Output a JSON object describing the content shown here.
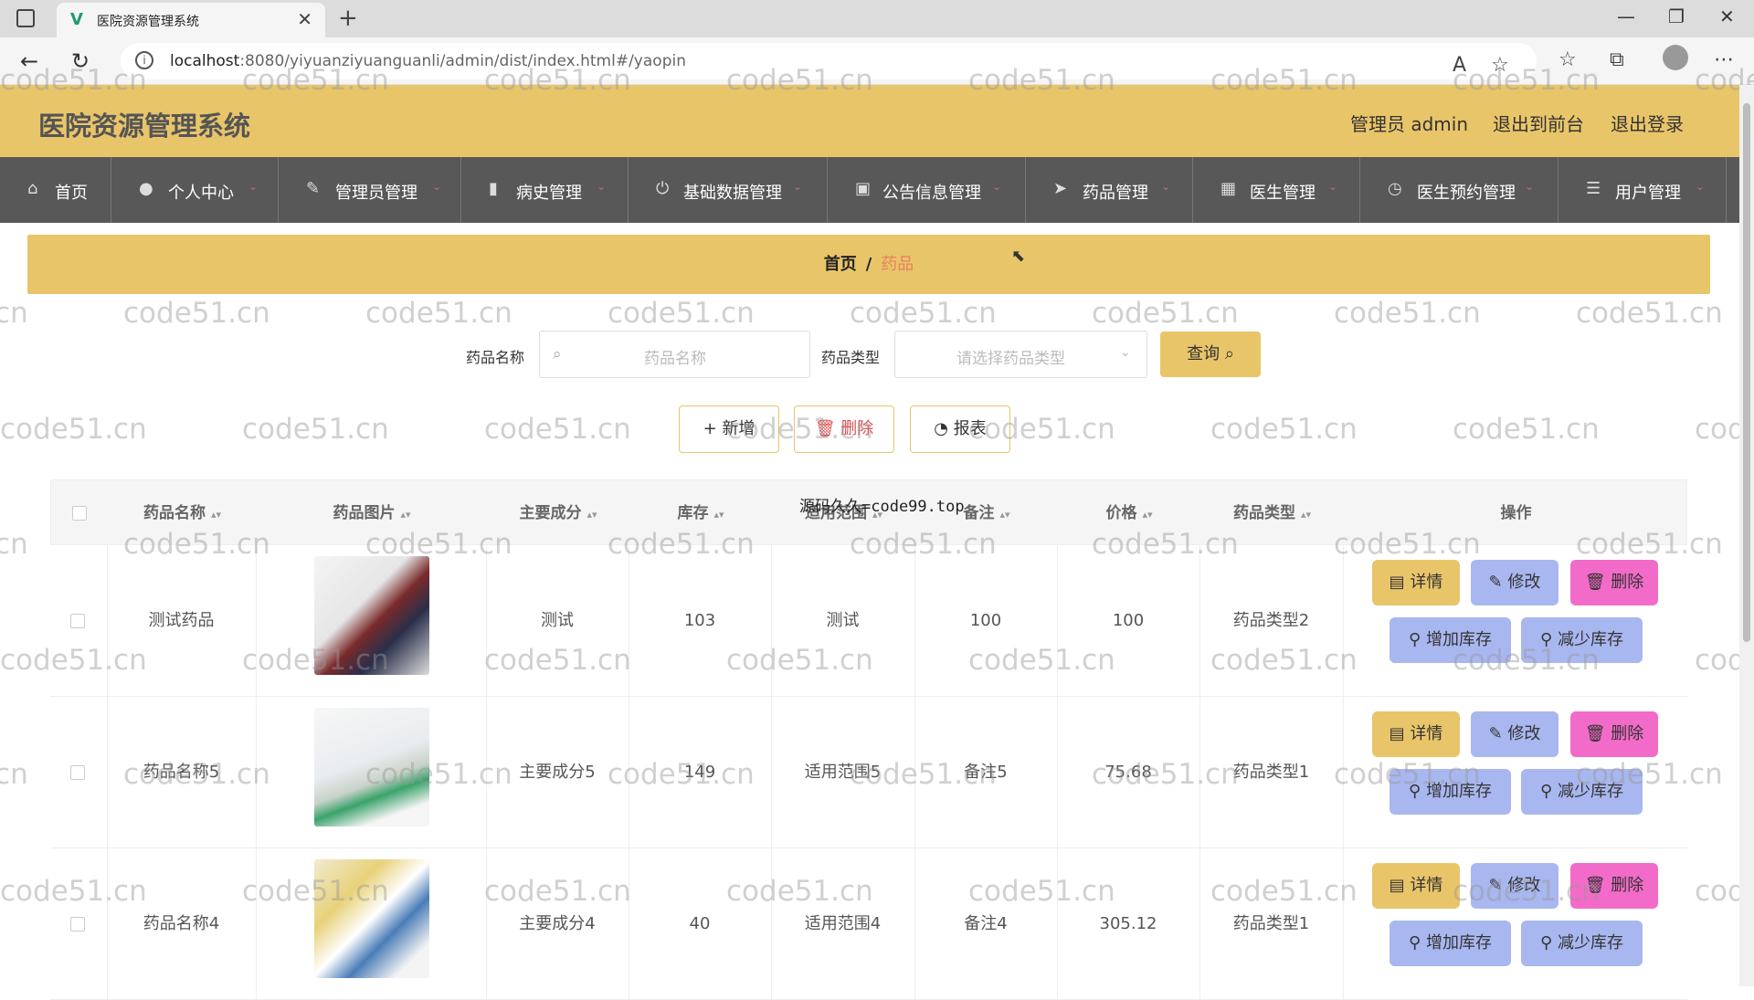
{
  "browser": {
    "tab_title": "医院资源管理系统",
    "url_host": "localhost",
    "url_rest": ":8080/yiyuanziyuanguanli/admin/dist/index.html#/yaopin"
  },
  "header": {
    "title": "医院资源管理系统",
    "admin_label": "管理员 admin",
    "to_front": "退出到前台",
    "logout": "退出登录"
  },
  "nav": [
    {
      "label": "首页",
      "icon": "home-icon"
    },
    {
      "label": "个人中心",
      "icon": "user-icon"
    },
    {
      "label": "管理员管理",
      "icon": "edit-icon"
    },
    {
      "label": "病史管理",
      "icon": "bar-chart-icon"
    },
    {
      "label": "基础数据管理",
      "icon": "power-icon"
    },
    {
      "label": "公告信息管理",
      "icon": "briefcase-icon"
    },
    {
      "label": "药品管理",
      "icon": "send-icon"
    },
    {
      "label": "医生管理",
      "icon": "grid-icon"
    },
    {
      "label": "医生预约管理",
      "icon": "clock-icon"
    },
    {
      "label": "用户管理",
      "icon": "list-icon"
    }
  ],
  "breadcrumb": {
    "home": "首页",
    "sep": "/",
    "current": "药品"
  },
  "search": {
    "name_label": "药品名称",
    "name_placeholder": "药品名称",
    "type_label": "药品类型",
    "type_placeholder": "请选择药品类型",
    "query_label": "查询"
  },
  "actions": {
    "add": "新增",
    "delete": "删除",
    "report": "报表"
  },
  "overlay_text": "源码久久=code99.top",
  "watermark": "code51.cn",
  "table": {
    "columns": [
      "药品名称",
      "药品图片",
      "主要成分",
      "库存",
      "适用范围",
      "备注",
      "价格",
      "药品类型",
      "操作"
    ],
    "op_labels": {
      "detail": "详情",
      "edit": "修改",
      "delete": "删除",
      "add_stock": "增加库存",
      "reduce_stock": "减少库存"
    },
    "rows": [
      {
        "name": "测试药品",
        "ingredient": "测试",
        "stock": "103",
        "scope": "测试",
        "note": "100",
        "price": "100",
        "type": "药品类型2"
      },
      {
        "name": "药品名称5",
        "ingredient": "主要成分5",
        "stock": "149",
        "scope": "适用范围5",
        "note": "备注5",
        "price": "75.68",
        "type": "药品类型1"
      },
      {
        "name": "药品名称4",
        "ingredient": "主要成分4",
        "stock": "40",
        "scope": "适用范围4",
        "note": "备注4",
        "price": "305.12",
        "type": "药品类型1"
      }
    ]
  }
}
